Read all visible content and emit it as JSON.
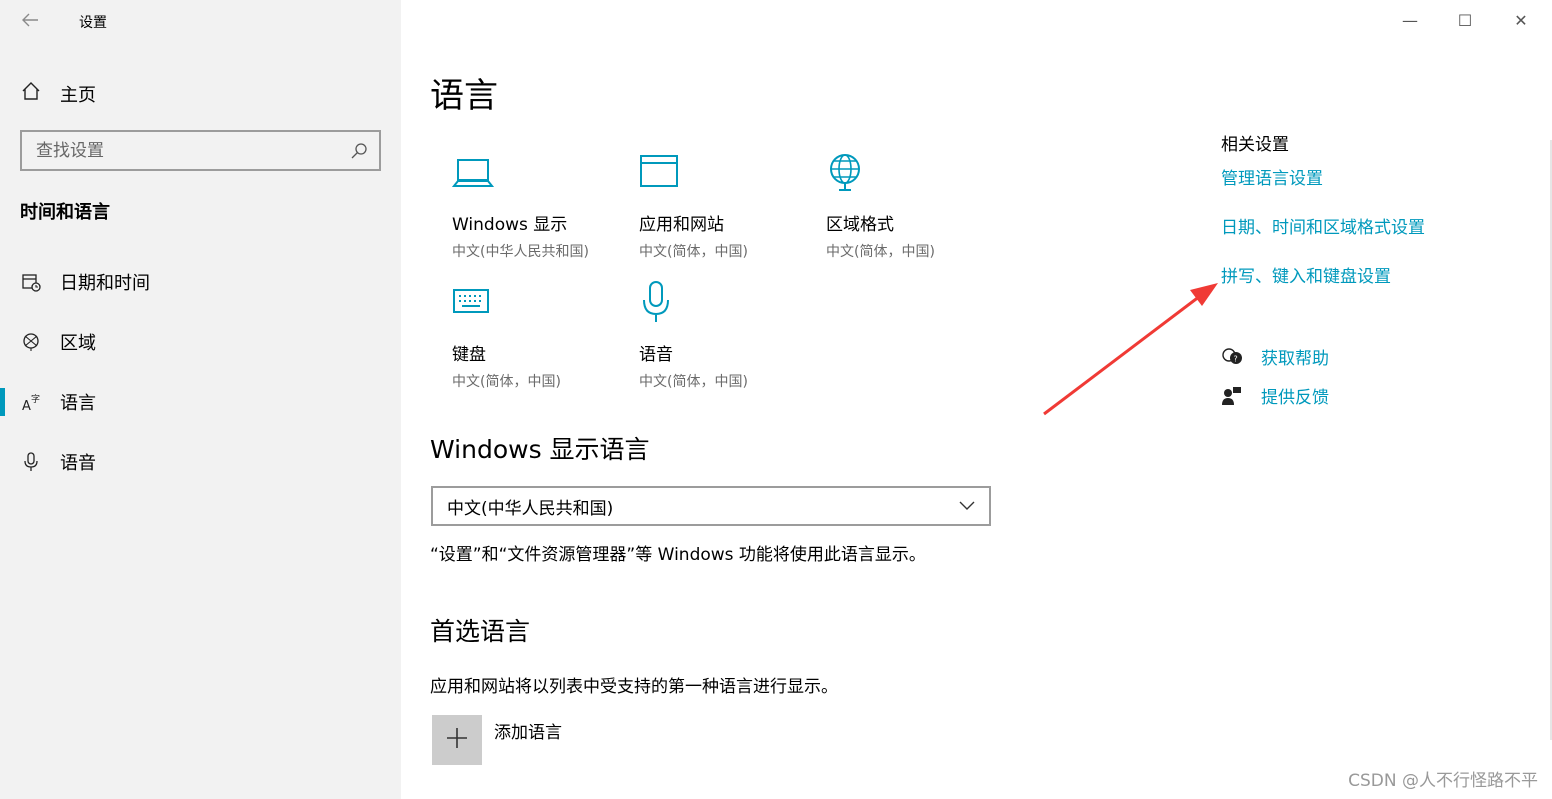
{
  "window": {
    "title": "设置",
    "controls": {
      "minimize": "—",
      "maximize": "☐",
      "close": "✕"
    }
  },
  "sidebar": {
    "home_label": "主页",
    "search_placeholder": "查找设置",
    "section_title": "时间和语言",
    "items": [
      {
        "label": "日期和时间",
        "icon": "calendar-clock-icon"
      },
      {
        "label": "区域",
        "icon": "globe-icon"
      },
      {
        "label": "语言",
        "icon": "language-icon",
        "active": true
      },
      {
        "label": "语音",
        "icon": "microphone-icon"
      }
    ]
  },
  "main": {
    "title": "语言",
    "tiles": [
      {
        "name": "Windows 显示",
        "sub": "中文(中华人民共和国)",
        "icon": "laptop-icon"
      },
      {
        "name": "应用和网站",
        "sub": "中文(简体，中国)",
        "icon": "browser-window-icon"
      },
      {
        "name": "区域格式",
        "sub": "中文(简体，中国)",
        "icon": "globe-icon"
      },
      {
        "name": "键盘",
        "sub": "中文(简体，中国)",
        "icon": "keyboard-icon"
      },
      {
        "name": "语音",
        "sub": "中文(简体，中国)",
        "icon": "microphone-icon"
      }
    ],
    "display_language": {
      "heading": "Windows 显示语言",
      "selected": "中文(中华人民共和国)",
      "description": "“设置”和“文件资源管理器”等 Windows 功能将使用此语言显示。"
    },
    "preferred": {
      "heading": "首选语言",
      "description": "应用和网站将以列表中受支持的第一种语言进行显示。",
      "add_label": "添加语言"
    }
  },
  "related": {
    "heading": "相关设置",
    "links": [
      "管理语言设置",
      "日期、时间和区域格式设置",
      "拼写、键入和键盘设置"
    ],
    "help": "获取帮助",
    "feedback": "提供反馈"
  },
  "watermark": "CSDN @人不行怪路不平",
  "colors": {
    "accent": "#0099bc",
    "sidebar_bg": "#f2f2f2",
    "annotation_arrow": "#f03a35"
  }
}
